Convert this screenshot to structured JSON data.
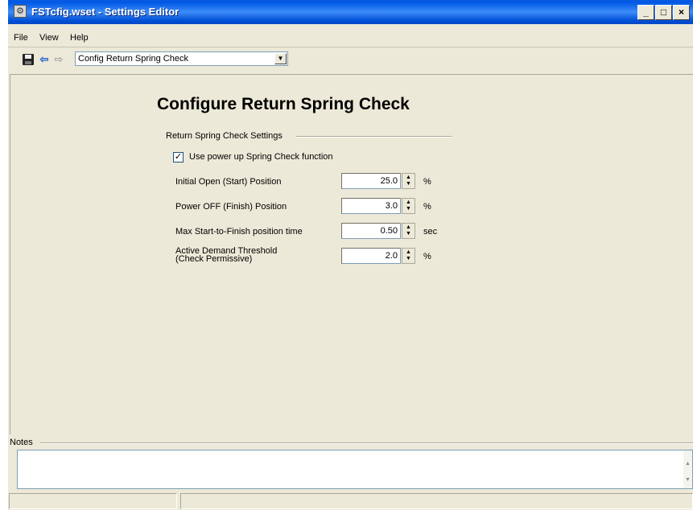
{
  "window": {
    "title": "FSTcfig.wset - Settings Editor",
    "minimize_glyph": "_",
    "maximize_glyph": "□",
    "close_glyph": "×"
  },
  "menu": {
    "items": [
      {
        "label": "File"
      },
      {
        "label": "View"
      },
      {
        "label": "Help"
      }
    ]
  },
  "toolbar": {
    "icons": [
      "save-icon",
      "back-arrow-icon",
      "forward-arrow-icon"
    ],
    "page_select_value": "Config Return Spring Check"
  },
  "page": {
    "title": "Configure Return Spring Check",
    "group_label": "Return Spring Check Settings",
    "checkbox": {
      "label": "Use power up Spring Check function",
      "checked": true
    },
    "fields": [
      {
        "label": "Initial Open (Start) Position",
        "value": "25.0",
        "unit": "%"
      },
      {
        "label": "Power OFF (Finish) Position",
        "value": "3.0",
        "unit": "%"
      },
      {
        "label": "Max Start-to-Finish position time",
        "value": "0.50",
        "unit": "sec"
      },
      {
        "label_line1": "Active Demand Threshold",
        "label_line2": "(Check Permissive)",
        "value": "2.0",
        "unit": "%"
      }
    ]
  },
  "notes": {
    "label": "Notes",
    "value": ""
  },
  "colors": {
    "titlebar": "#0058e6",
    "window_bg": "#ece9d8",
    "input_border": "#7f9db9"
  }
}
